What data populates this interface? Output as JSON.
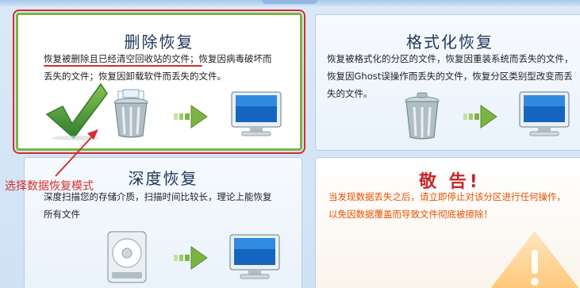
{
  "cards": {
    "delete_recovery": {
      "title": "删除恢复",
      "desc_line1_underlined": "恢复被删除且已经清空回收站的文件",
      "desc_line1_rest": "；恢复因病毒破坏而",
      "desc_line2": "丢失的文件；恢复因卸载软件而丢失的文件。"
    },
    "format_recovery": {
      "title": "格式化恢复",
      "desc_line1": "恢复被格式化的分区的文件，恢复因重装系统而丢失的文件，",
      "desc_line2": "恢复因Ghost误操作而丢失的文件，恢复分区类别型改变而丢",
      "desc_line3": "失的文件。"
    },
    "deep_recovery": {
      "title": "深度恢复",
      "desc_line1": "深度扫描您的存储介质，扫描时间比较长，理论上能恢复",
      "desc_line2": "所有文件"
    },
    "warning": {
      "title": "敬 告!",
      "line1": "当发现数据丢失之后，请立即停止对该分区进行任何操作，",
      "line2": "以免因数据覆盖而导致文件彻底被擦除！"
    }
  },
  "annotation": {
    "text": "选择数据恢复模式"
  },
  "colors": {
    "selected_border": "#7cb341",
    "annotation_red": "#d32f2f",
    "warning_orange": "#e65100",
    "title_blue": "#1d3557"
  },
  "icons": [
    "checkmark-icon",
    "trash-bin-icon",
    "arrow-right-icon",
    "monitor-icon",
    "hard-drive-icon",
    "warning-triangle-icon"
  ]
}
